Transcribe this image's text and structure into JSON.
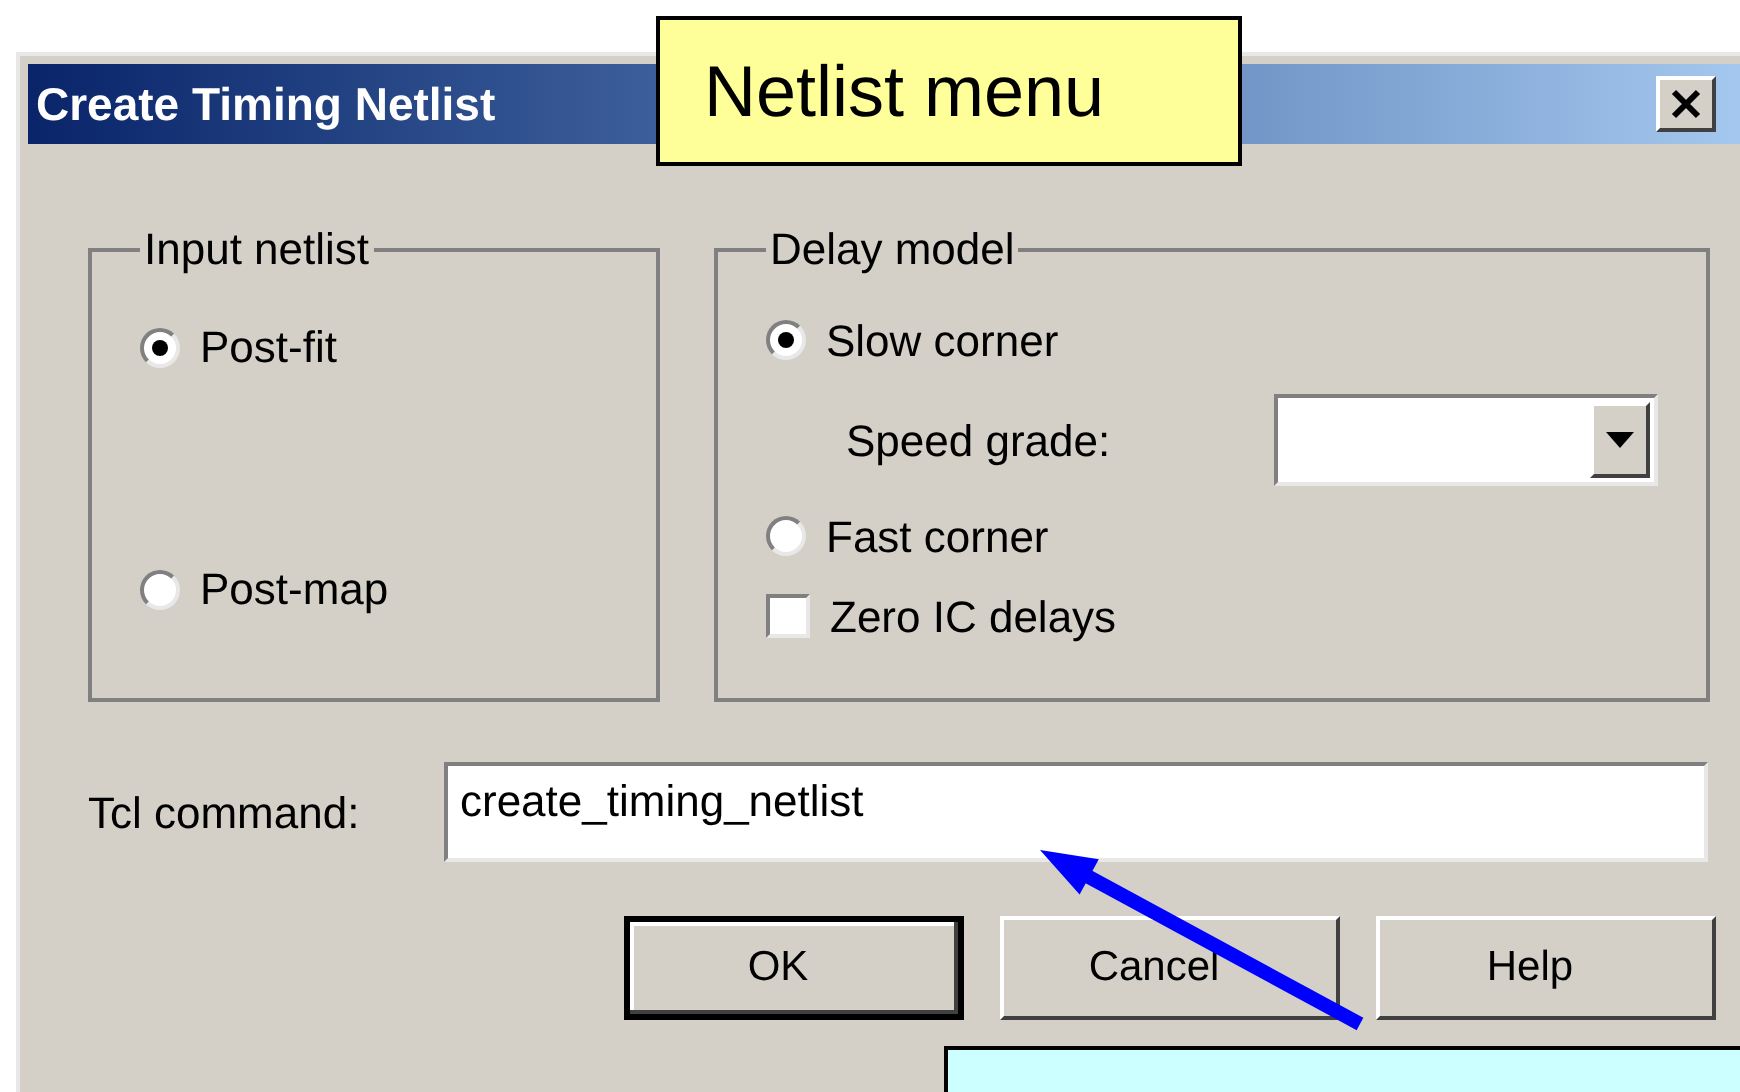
{
  "callout": {
    "text": "Netlist menu"
  },
  "dialog": {
    "title": "Create Timing Netlist",
    "input_netlist": {
      "title": "Input netlist",
      "options": [
        {
          "label": "Post-fit",
          "selected": true
        },
        {
          "label": "Post-map",
          "selected": false
        }
      ]
    },
    "delay_model": {
      "title": "Delay model",
      "items": [
        {
          "kind": "radio",
          "label": "Slow corner",
          "selected": true
        },
        {
          "kind": "select",
          "label": "Speed grade:"
        },
        {
          "kind": "radio",
          "label": "Fast corner",
          "selected": false
        },
        {
          "kind": "checkbox",
          "label": "Zero IC delays",
          "checked": false
        }
      ]
    },
    "tcl_command": {
      "label": "Tcl command:",
      "value": "create_timing_netlist"
    },
    "buttons": [
      {
        "label": "OK",
        "default": true
      },
      {
        "label": "Cancel",
        "default": false
      },
      {
        "label": "Help",
        "default": false
      }
    ]
  }
}
